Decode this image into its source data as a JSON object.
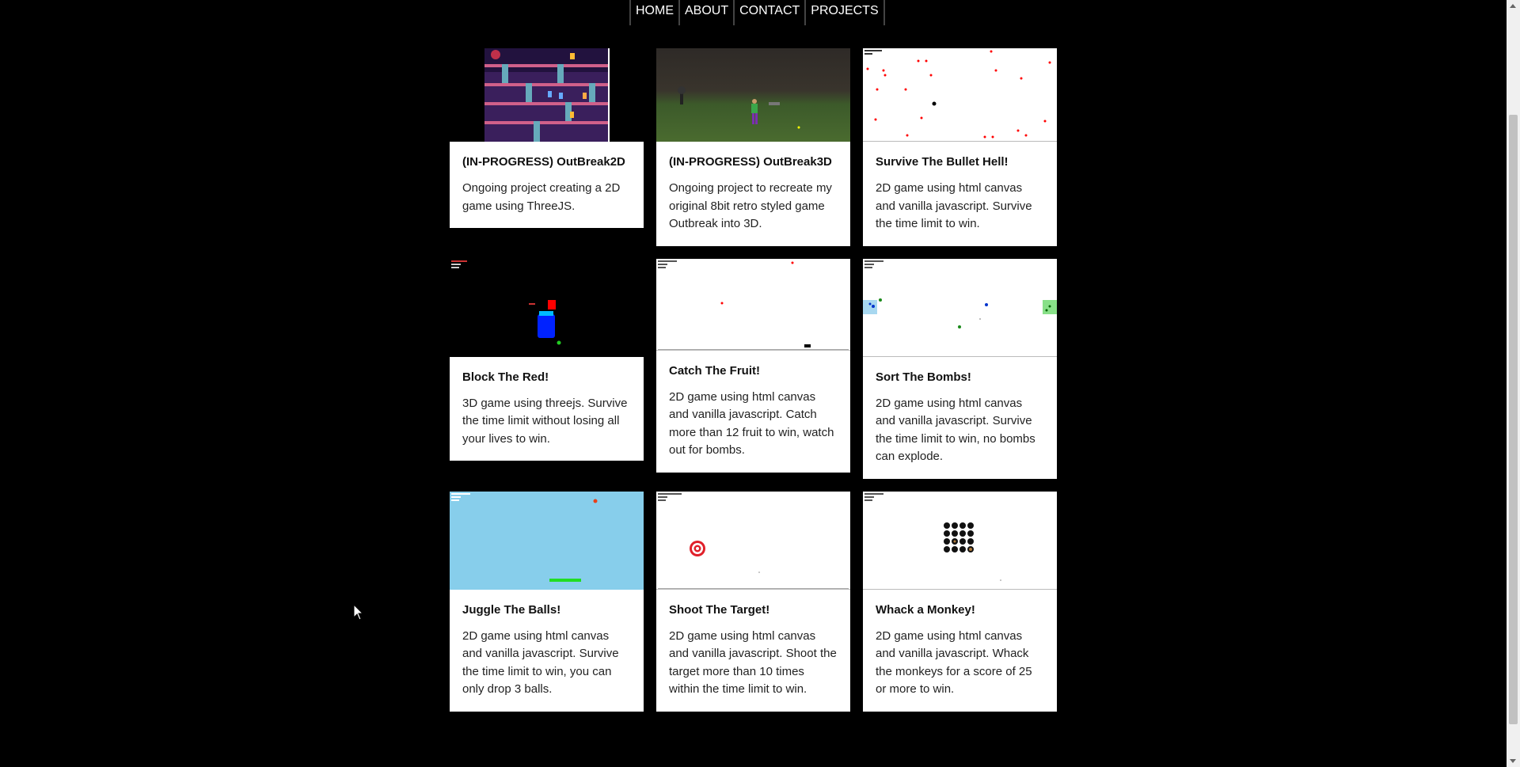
{
  "nav": {
    "items": [
      {
        "label": "HOME"
      },
      {
        "label": "ABOUT"
      },
      {
        "label": "CONTACT"
      },
      {
        "label": "PROJECTS"
      }
    ]
  },
  "projects": [
    {
      "title": "(IN-PROGRESS) OutBreak2D",
      "description": "Ongoing project creating a 2D game using ThreeJS."
    },
    {
      "title": "(IN-PROGRESS) OutBreak3D",
      "description": "Ongoing project to recreate my original 8bit retro styled game Outbreak into 3D."
    },
    {
      "title": "Survive The Bullet Hell!",
      "description": "2D game using html canvas and vanilla javascript. Survive the time limit to win."
    },
    {
      "title": "Block The Red!",
      "description": "3D game using threejs. Survive the time limit without losing all your lives to win."
    },
    {
      "title": "Catch The Fruit!",
      "description": "2D game using html canvas and vanilla javascript. Catch more than 12 fruit to win, watch out for bombs."
    },
    {
      "title": "Sort The Bombs!",
      "description": "2D game using html canvas and vanilla javascript. Survive the time limit to win, no bombs can explode."
    },
    {
      "title": "Juggle The Balls!",
      "description": "2D game using html canvas and vanilla javascript. Survive the time limit to win, you can only drop 3 balls."
    },
    {
      "title": "Shoot The Target!",
      "description": "2D game using html canvas and vanilla javascript. Shoot the target more than 10 times within the time limit to win."
    },
    {
      "title": "Whack a Monkey!",
      "description": "2D game using html canvas and vanilla javascript. Whack the monkeys for a score of 25 or more to win."
    }
  ],
  "colors": {
    "background": "#000000",
    "card": "#ffffff",
    "sky": "#87ceeb"
  }
}
